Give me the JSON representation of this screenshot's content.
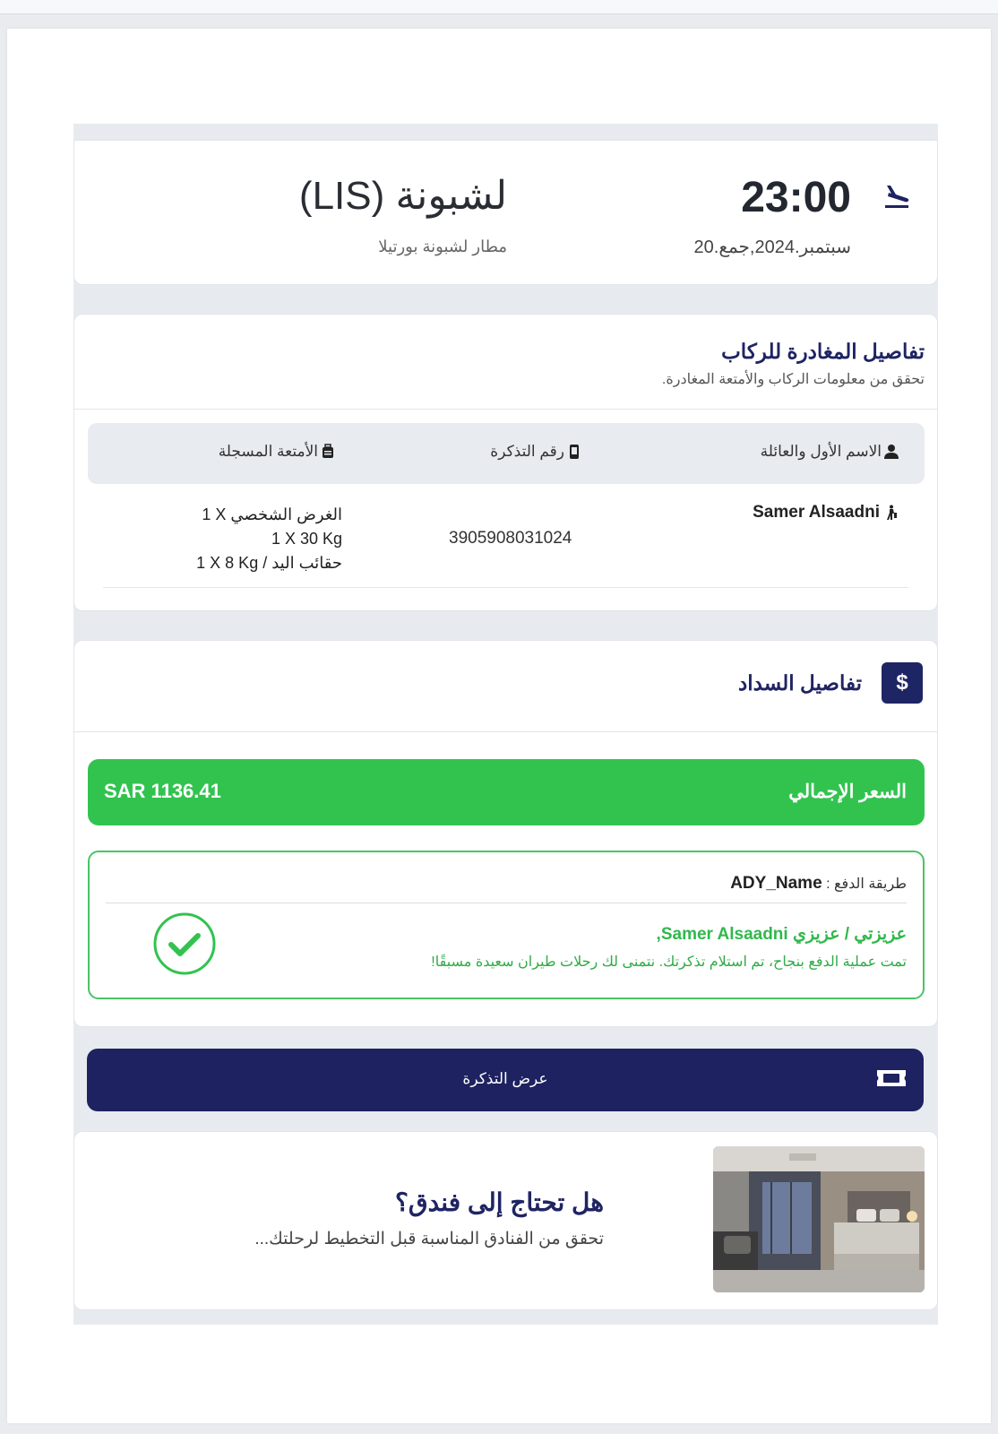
{
  "arrival": {
    "time": "23:00",
    "date": "20.سبتمبر.2024,جمع",
    "city": "لشبونة (LIS)",
    "airport": "مطار لشبونة بورتيلا",
    "icon": "plane-landing-icon"
  },
  "passengers": {
    "title": "تفاصيل المغادرة للركاب",
    "subtitle": "تحقق من معلومات الركاب والأمتعة المغادرة.",
    "columns": {
      "name": "الاسم الأول والعائلة",
      "ticket": "رقم التذكرة",
      "baggage": "الأمتعة المسجلة"
    },
    "rows": [
      {
        "name": "Samer Alsaadni",
        "ticket_number": "3905908031024",
        "baggage": [
          "1 X الغرض الشخصي",
          "1 X 30 Kg",
          "1 X 8 Kg / حقائب اليد"
        ]
      }
    ]
  },
  "payment": {
    "title": "تفاصيل السداد",
    "icon_symbol": "$",
    "total_label": "السعر الإجمالي",
    "total_value": "SAR 1136.41",
    "method_label": "طريقة الدفع :",
    "method_value": "ADY_Name",
    "greeting": "عزيزتي / عزيزي Samer Alsaadni,",
    "success_message": "تمت عملية الدفع بنجاح، تم استلام تذكرتك. نتمنى لك رحلات طيران سعيدة مسبقًا!",
    "success_color": "#32c34f"
  },
  "view_ticket": {
    "label": "عرض التذكرة",
    "icon": "ticket-icon"
  },
  "hotel": {
    "title": "هل تحتاج إلى فندق؟",
    "subtitle": "تحقق من الفنادق المناسبة قبل التخطيط لرحلتك..."
  },
  "colors": {
    "brand_navy": "#1e2261",
    "success_green": "#32c34f",
    "panel_gray": "#e8ebef"
  }
}
